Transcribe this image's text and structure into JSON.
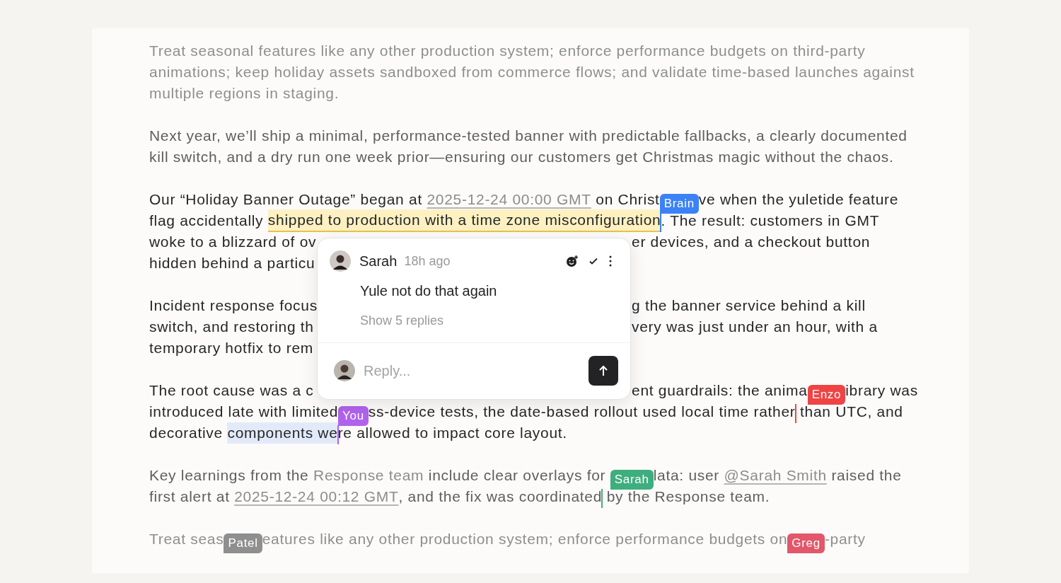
{
  "paragraphs": [
    {
      "dimmed": true,
      "faint": true,
      "lines": [
        {
          "segments": [
            {
              "kind": "text",
              "text": "Treat seasonal features like any other production system; enforce performance budgets on third-party"
            }
          ]
        },
        {
          "segments": [
            {
              "kind": "text",
              "text": "animations; keep holiday assets sandboxed from commerce flows; and validate time-based launches against"
            }
          ]
        },
        {
          "segments": [
            {
              "kind": "text",
              "text": "multiple regions in staging."
            }
          ]
        }
      ]
    },
    {
      "dimmed": true,
      "faint": false,
      "lines": [
        {
          "segments": [
            {
              "kind": "text",
              "text": "Next year, we’ll ship a minimal, performance-tested banner with predictable fallbacks, a clearly documented"
            }
          ]
        },
        {
          "segments": [
            {
              "kind": "text",
              "text": "kill switch, and a dry run one week prior—ensuring our customers get Christmas magic without the chaos."
            }
          ]
        }
      ]
    },
    {
      "dimmed": false,
      "faint": false,
      "lines": [
        {
          "segments": [
            {
              "kind": "text",
              "text": "Our “Holiday Banner Outage” began at "
            },
            {
              "kind": "link",
              "text": "2025-12-24 00:00 GMT"
            },
            {
              "kind": "text",
              "text": " on Christ"
            },
            {
              "kind": "label",
              "name": "Brain",
              "color": "#3b82f6"
            },
            {
              "kind": "text",
              "text": "ve when the yuletide feature"
            }
          ]
        },
        {
          "segments": [
            {
              "kind": "text",
              "text": "flag accidentally "
            },
            {
              "kind": "highlight",
              "text": "shipped to production with a time zone misconfiguration"
            },
            {
              "kind": "caret",
              "color": "#3b82f6"
            },
            {
              "kind": "text",
              "text": ". The result: customers in GMT"
            }
          ]
        },
        {
          "segments": [
            {
              "kind": "text",
              "text": "woke to a blizzard of ov"
            }
          ],
          "right": [
            {
              "kind": "text",
              "text": "er devices, and a checkout button"
            }
          ]
        },
        {
          "segments": [
            {
              "kind": "text",
              "text": "hidden behind a particu"
            }
          ]
        }
      ]
    },
    {
      "dimmed": false,
      "faint": false,
      "lines": [
        {
          "segments": [
            {
              "kind": "text",
              "text": "Incident response focus"
            }
          ],
          "right": [
            {
              "kind": "text",
              "text": "g the banner service behind a kill"
            }
          ]
        },
        {
          "segments": [
            {
              "kind": "text",
              "text": "switch, and restoring th"
            }
          ],
          "right": [
            {
              "kind": "text",
              "text": "very was just under an hour, with a"
            }
          ]
        },
        {
          "segments": [
            {
              "kind": "text",
              "text": "temporary hotfix to rem"
            }
          ]
        }
      ]
    },
    {
      "dimmed": false,
      "faint": false,
      "lines": [
        {
          "segments": [
            {
              "kind": "text",
              "text": "The root cause was a c"
            }
          ],
          "right": [
            {
              "kind": "text",
              "text": "ent guardrails: the anima"
            },
            {
              "kind": "label",
              "name": "Enzo",
              "color": "#ef4444"
            },
            {
              "kind": "text",
              "text": "ibrary was"
            }
          ]
        },
        {
          "segments": [
            {
              "kind": "text",
              "text": "introduced late with limited"
            },
            {
              "kind": "label",
              "name": "You",
              "color": "#b062ec"
            },
            {
              "kind": "text",
              "text": "ss-device tests, the date-based rollout used local time rather"
            },
            {
              "kind": "caret",
              "color": "#ef4444"
            },
            {
              "kind": "text",
              "text": " than UTC, and"
            }
          ]
        },
        {
          "segments": [
            {
              "kind": "text",
              "text": "decorative "
            },
            {
              "kind": "selection",
              "text": "components we"
            },
            {
              "kind": "caret",
              "color": "#b062ec"
            },
            {
              "kind": "text",
              "text": "re allowed to impact core layout."
            }
          ]
        }
      ]
    },
    {
      "dimmed": true,
      "faint": false,
      "lines": [
        {
          "segments": [
            {
              "kind": "text",
              "text": "Key learnings from the "
            },
            {
              "kind": "mention",
              "text": "Response team"
            },
            {
              "kind": "text",
              "text": " include clear overlays for "
            },
            {
              "kind": "label",
              "name": "Sarah",
              "color": "#3fae7e"
            },
            {
              "kind": "text",
              "text": "lata: user "
            },
            {
              "kind": "link",
              "text": "@Sarah Smith"
            },
            {
              "kind": "text",
              "text": " raised the"
            }
          ]
        },
        {
          "segments": [
            {
              "kind": "text",
              "text": "first alert at "
            },
            {
              "kind": "link",
              "text": "2025-12-24 00:12 GMT"
            },
            {
              "kind": "text",
              "text": ", and the fix was coordinated"
            },
            {
              "kind": "caret",
              "color": "#3fae7e"
            },
            {
              "kind": "text",
              "text": " by the Response team."
            }
          ]
        }
      ]
    },
    {
      "dimmed": true,
      "faint": true,
      "lines": [
        {
          "segments": [
            {
              "kind": "text",
              "text": "Treat seas"
            },
            {
              "kind": "label",
              "name": "Patel",
              "color": "#8f8f8f"
            },
            {
              "kind": "text",
              "text": "eatures like any other production system; enforce performance budgets on"
            },
            {
              "kind": "label",
              "name": "Greg",
              "color": "#e2576a"
            },
            {
              "kind": "text",
              "text": "-party"
            }
          ]
        }
      ]
    }
  ],
  "comment": {
    "author": "Sarah",
    "time": "18h ago",
    "body": "Yule not do that again",
    "replies": "Show 5 replies",
    "reply_placeholder": "Reply..."
  }
}
